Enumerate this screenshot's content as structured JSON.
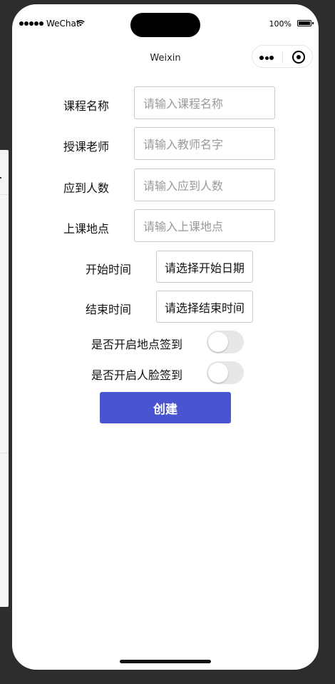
{
  "status_bar": {
    "carrier": "WeChat",
    "battery": "100%"
  },
  "nav": {
    "title": "Weixin"
  },
  "form": {
    "course_name": {
      "label": "课程名称",
      "placeholder": "请输入课程名称"
    },
    "teacher": {
      "label": "授课老师",
      "placeholder": "请输入教师名字"
    },
    "expected_count": {
      "label": "应到人数",
      "placeholder": "请输入应到人数"
    },
    "location": {
      "label": "上课地点",
      "placeholder": "请输入上课地点"
    },
    "start_time": {
      "label": "开始时间",
      "value": "请选择开始日期"
    },
    "end_time": {
      "label": "结束时间",
      "value": "请选择结束时间"
    },
    "location_checkin": {
      "label": "是否开启地点签到",
      "on": false
    },
    "face_checkin": {
      "label": "是否开启人脸签到",
      "on": false
    },
    "submit_label": "创建"
  },
  "colors": {
    "primary": "#4a54d1",
    "switch_off": "#e7e7e7"
  }
}
